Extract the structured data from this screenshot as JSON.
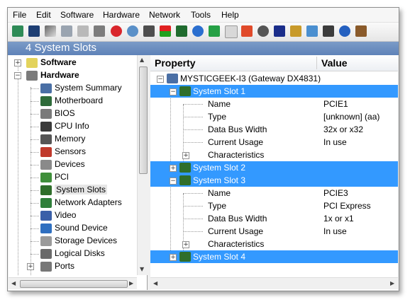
{
  "menu": [
    "File",
    "Edit",
    "Software",
    "Hardware",
    "Network",
    "Tools",
    "Help"
  ],
  "toolbar_icons": [
    "exit-icon",
    "save-icon",
    "cut-icon",
    "copy-icon",
    "paste-icon",
    "print-icon",
    "stop-icon",
    "find-icon",
    "refresh-icon",
    "color-icon",
    "chart-icon",
    "globe-icon",
    "sync-icon",
    "report-icon",
    "pdf-icon",
    "clock-icon",
    "shield-icon",
    "chart2-icon",
    "network-icon",
    "tasks-icon",
    "help-icon",
    "coffee-icon"
  ],
  "title": "4 System Slots",
  "tree": {
    "software": "Software",
    "hardware": "Hardware",
    "items": [
      "System Summary",
      "Motherboard",
      "BIOS",
      "CPU Info",
      "Memory",
      "Sensors",
      "Devices",
      "PCI",
      "System Slots",
      "Network Adapters",
      "Video",
      "Sound Device",
      "Storage Devices",
      "Logical Disks",
      "Ports"
    ]
  },
  "table": {
    "col_property": "Property",
    "col_value": "Value",
    "root": "MYSTICGEEK-I3 (Gateway DX4831)",
    "slot1": "System Slot 1",
    "slot1_rows": [
      {
        "name": "Name",
        "value": "PCIE1"
      },
      {
        "name": "Type",
        "value": "[unknown] (aa)"
      },
      {
        "name": "Data Bus Width",
        "value": "32x or x32"
      },
      {
        "name": "Current Usage",
        "value": "In use"
      }
    ],
    "slot1_char": "Characteristics",
    "slot2": "System Slot 2",
    "slot3": "System Slot 3",
    "slot3_rows": [
      {
        "name": "Name",
        "value": "PCIE3"
      },
      {
        "name": "Type",
        "value": "PCI Express"
      },
      {
        "name": "Data Bus Width",
        "value": "1x or x1"
      },
      {
        "name": "Current Usage",
        "value": "In use"
      }
    ],
    "slot3_char": "Characteristics",
    "slot4": "System Slot 4"
  },
  "colors": {
    "selection": "#3399ff",
    "titlebar": "#6a8cc0"
  }
}
